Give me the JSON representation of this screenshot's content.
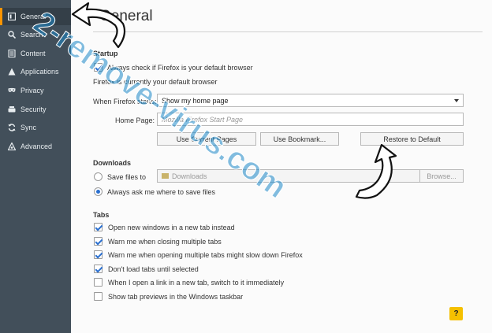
{
  "sidebar": {
    "items": [
      {
        "label": "General",
        "icon": "general-icon"
      },
      {
        "label": "Search",
        "icon": "search-icon"
      },
      {
        "label": "Content",
        "icon": "content-icon"
      },
      {
        "label": "Applications",
        "icon": "applications-icon"
      },
      {
        "label": "Privacy",
        "icon": "privacy-mask-icon"
      },
      {
        "label": "Security",
        "icon": "security-icon"
      },
      {
        "label": "Sync",
        "icon": "sync-icon"
      },
      {
        "label": "Advanced",
        "icon": "advanced-icon"
      }
    ],
    "selected": "General"
  },
  "main": {
    "title": "General",
    "startup": {
      "heading": "Startup",
      "default_check_label": "Always check if Firefox is your default browser",
      "default_check_checked": true,
      "default_status": "Firefox is currently your default browser",
      "when_starts_label": "When Firefox starts:",
      "when_starts_value": "Show my home page",
      "home_page_label": "Home Page:",
      "home_page_placeholder": "Mozilla Firefox Start Page",
      "use_current_label": "Use Current Pages",
      "use_bookmark_label": "Use Bookmark...",
      "restore_default_label": "Restore to Default"
    },
    "downloads": {
      "heading": "Downloads",
      "save_files_label": "Save files to",
      "save_files_path": "Downloads",
      "browse_label": "Browse...",
      "always_ask_label": "Always ask me where to save files",
      "selected_option": "always_ask"
    },
    "tabs": {
      "heading": "Tabs",
      "options": [
        {
          "label": "Open new windows in a new tab instead",
          "checked": true
        },
        {
          "label": "Warn me when closing multiple tabs",
          "checked": true
        },
        {
          "label": "Warn me when opening multiple tabs might slow down Firefox",
          "checked": true
        },
        {
          "label": "Don't load tabs until selected",
          "checked": true
        },
        {
          "label": "When I open a link in a new tab, switch to it immediately",
          "checked": false
        },
        {
          "label": "Show tab previews in the Windows taskbar",
          "checked": false
        }
      ]
    },
    "help_label": "?"
  },
  "watermark": {
    "text": "2-remove-virus.com",
    "color": "#1e88c8"
  },
  "colors": {
    "sidebar_bg": "#424f5a",
    "sidebar_selected": "#343f48",
    "accent_orange": "#ff9500",
    "check_blue": "#2a6fcf",
    "help_yellow": "#f5c000"
  }
}
